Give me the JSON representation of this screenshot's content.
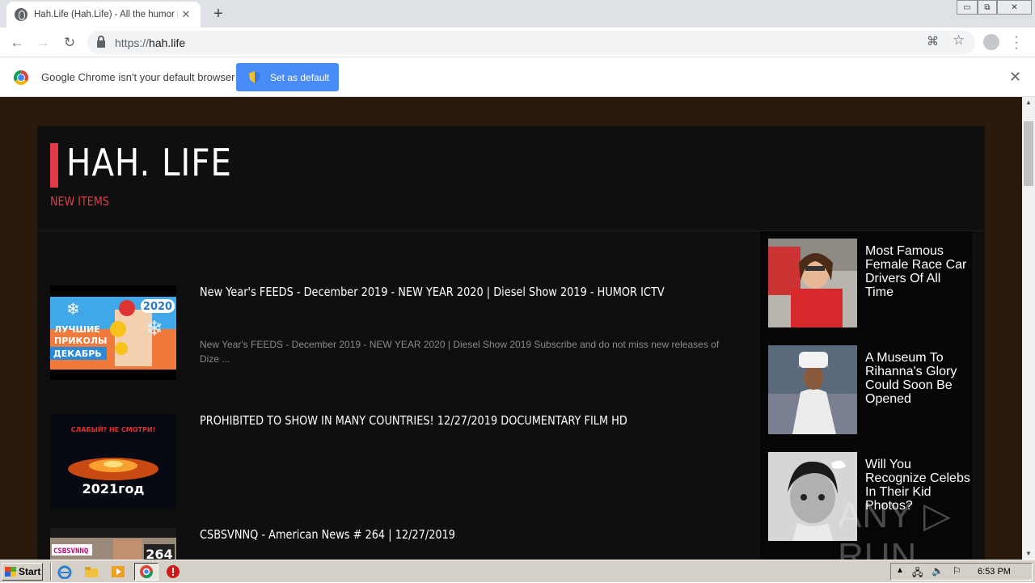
{
  "browser": {
    "tab_title": "Hah.Life (Hah.Life) - All the humor in",
    "tab_close": "✕",
    "new_tab": "+",
    "url_scheme": "https://",
    "url_host": "hah.life",
    "window_controls": [
      "▭",
      "⧉",
      "✕"
    ]
  },
  "infobar": {
    "message": "Google Chrome isn't your default browser",
    "button_label": "Set as default",
    "close": "✕"
  },
  "site": {
    "logo": "HAH. LIFE",
    "section_label": "NEW ITEMS",
    "accent_color": "#e03a48",
    "feed": [
      {
        "title": "New Year's FEEDS - December 2019 - NEW YEAR 2020 | Diesel Show 2019 - HUMOR ICTV",
        "description": "New Year's FEEDS - December 2019 - NEW YEAR 2020 | Diesel Show 2019 Subscribe and do not miss new releases of Dize ...",
        "thumb_text": [
          "2020",
          "ЛУЧШИЕ",
          "ПРИКОЛЫ",
          "ДЕКАБРЬ"
        ]
      },
      {
        "title": "PROHIBITED TO SHOW IN MANY COUNTRIES! 12/27/2019 DOCUMENTARY FILM HD",
        "description": "",
        "thumb_text": [
          "СЛАБЫЙ? НЕ СМОТРИ!",
          "2021год"
        ]
      },
      {
        "title": "CSBSVNNQ - American News # 264 | 12/27/2019",
        "description": "",
        "thumb_text": [
          "CSBSVNNQ",
          "264"
        ]
      }
    ],
    "sidebar": [
      {
        "title": "Most Famous Female Race Car Drivers Of All Time"
      },
      {
        "title": "A Museum To Rihanna's Glory Could Soon Be Opened"
      },
      {
        "title": "Will You Recognize Celebs In Their Kid Photos?"
      }
    ]
  },
  "watermark": "ANY ▷ RUN",
  "taskbar": {
    "start_label": "Start",
    "clock": "6:53 PM"
  }
}
